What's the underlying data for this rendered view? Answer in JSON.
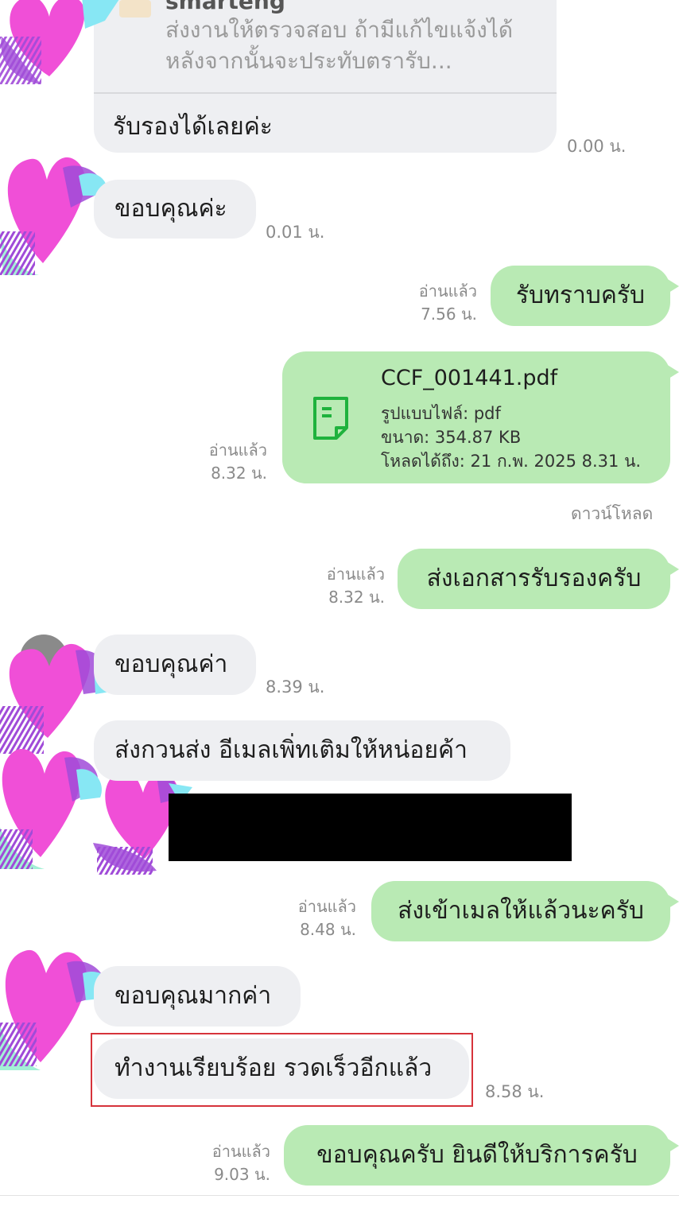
{
  "quoted_message": {
    "sender_name": "smarteng",
    "preview_text": "ส่งงานให้ตรวจสอบ ถ้ามีแก้ไขแจ้งได้ หลังจากนั้นจะประทับตรารับ...",
    "reply_text": "รับรองได้เลยค่ะ",
    "time": "0.00 น."
  },
  "messages": [
    {
      "side": "in",
      "text": "ขอบคุณค่ะ",
      "time": "0.01 น."
    },
    {
      "side": "out",
      "text": "รับทราบครับ",
      "read_label": "อ่านแล้ว",
      "time": "7.56 น."
    },
    {
      "side": "out",
      "type": "file",
      "file_name": "CCF_001441.pdf",
      "file_type": "รูปแบบไฟล์: pdf",
      "file_size": "ขนาด: 354.87 KB",
      "file_expiry": "โหลดได้ถึง: 21 ก.พ. 2025 8.31 น.",
      "download_label": "ดาวน์โหลด",
      "read_label": "อ่านแล้ว",
      "time": "8.32 น.",
      "icon": "document-icon"
    },
    {
      "side": "out",
      "text": "ส่งเอกสารรับรองครับ",
      "read_label": "อ่านแล้ว",
      "time": "8.32 น."
    },
    {
      "side": "in",
      "text": "ขอบคุณค่า",
      "time": "8.39 น."
    },
    {
      "side": "in",
      "text": "ส่งกวนส่ง อีเมลเพิ่ทเติมให้หน่อยค้า"
    },
    {
      "side": "out",
      "text": "ส่งเข้าเมลให้แล้วนะครับ",
      "read_label": "อ่านแล้ว",
      "time": "8.48 น."
    },
    {
      "side": "in",
      "text": "ขอบคุณมากค่า"
    },
    {
      "side": "in",
      "text": "ทำงานเรียบร้อย รวดเร็วอีกแล้ว",
      "time": "8.58 น.",
      "highlighted": true
    },
    {
      "side": "out",
      "text": "ขอบคุณครับ ยินดีให้บริการครับ",
      "read_label": "อ่านแล้ว",
      "time": "9.03 น."
    }
  ],
  "colors": {
    "incoming_bubble": "#eeeff2",
    "outgoing_bubble": "#b9eab4",
    "file_icon": "#1fb23d",
    "highlight_border": "#d6333b",
    "heart_pink": "#f04fd7",
    "heart_purple": "#a04bd8",
    "heart_cyan": "#87e7f4",
    "heart_mint": "#a3f0d6"
  }
}
